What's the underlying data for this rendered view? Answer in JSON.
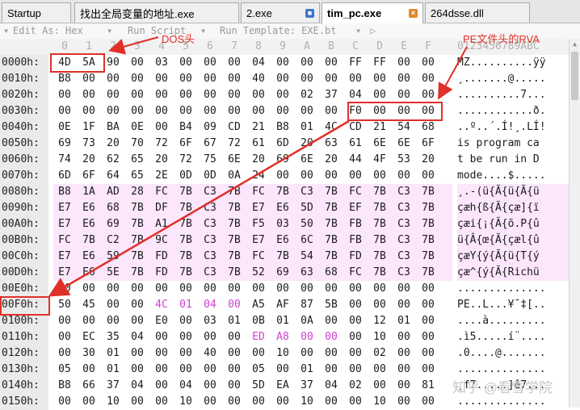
{
  "tabs": [
    {
      "label": "Startup",
      "icon": null,
      "active": false
    },
    {
      "label": "找出全局变量的地址.exe",
      "icon": null,
      "active": false
    },
    {
      "label": "2.exe",
      "icon": "lock-icon",
      "active": false
    },
    {
      "label": "tim_pc.exe",
      "icon": "close-icon",
      "active": true
    },
    {
      "label": "264dsse.dll",
      "icon": null,
      "active": false
    }
  ],
  "toolbar": {
    "edit_as": "Edit As: Hex",
    "run_script": "Run Script",
    "run_template": "Run Template: EXE.bt",
    "run_icon": "play-icon"
  },
  "columns": [
    "0",
    "1",
    "2",
    "3",
    "4",
    "5",
    "6",
    "7",
    "8",
    "9",
    "A",
    "B",
    "C",
    "D",
    "E",
    "F"
  ],
  "ascii_header": "0123456789ABC",
  "rows": [
    {
      "offset": "0000h:",
      "bytes": [
        "4D",
        "5A",
        "90",
        "00",
        "03",
        "00",
        "00",
        "00",
        "04",
        "00",
        "00",
        "00",
        "FF",
        "FF",
        "00",
        "00"
      ],
      "ascii": "MZ..........ÿÿ",
      "pink": false
    },
    {
      "offset": "0010h:",
      "bytes": [
        "B8",
        "00",
        "00",
        "00",
        "00",
        "00",
        "00",
        "00",
        "40",
        "00",
        "00",
        "00",
        "00",
        "00",
        "00",
        "00"
      ],
      "ascii": "¸.......@.....",
      "pink": false
    },
    {
      "offset": "0020h:",
      "bytes": [
        "00",
        "00",
        "00",
        "00",
        "00",
        "00",
        "00",
        "00",
        "00",
        "00",
        "02",
        "37",
        "04",
        "00",
        "00",
        "00"
      ],
      "ascii": "..........7...",
      "pink": false
    },
    {
      "offset": "0030h:",
      "bytes": [
        "00",
        "00",
        "00",
        "00",
        "00",
        "00",
        "00",
        "00",
        "00",
        "00",
        "00",
        "00",
        "F0",
        "00",
        "00",
        "00"
      ],
      "ascii": "............ð.",
      "pink": false
    },
    {
      "offset": "0040h:",
      "bytes": [
        "0E",
        "1F",
        "BA",
        "0E",
        "00",
        "B4",
        "09",
        "CD",
        "21",
        "B8",
        "01",
        "4C",
        "CD",
        "21",
        "54",
        "68"
      ],
      "ascii": "..º..´.Í!¸.LÍ!",
      "pink": false
    },
    {
      "offset": "0050h:",
      "bytes": [
        "69",
        "73",
        "20",
        "70",
        "72",
        "6F",
        "67",
        "72",
        "61",
        "6D",
        "20",
        "63",
        "61",
        "6E",
        "6E",
        "6F"
      ],
      "ascii": "is program ca",
      "pink": false
    },
    {
      "offset": "0060h:",
      "bytes": [
        "74",
        "20",
        "62",
        "65",
        "20",
        "72",
        "75",
        "6E",
        "20",
        "69",
        "6E",
        "20",
        "44",
        "4F",
        "53",
        "20"
      ],
      "ascii": "t be run in D",
      "pink": false
    },
    {
      "offset": "0070h:",
      "bytes": [
        "6D",
        "6F",
        "64",
        "65",
        "2E",
        "0D",
        "0D",
        "0A",
        "24",
        "00",
        "00",
        "00",
        "00",
        "00",
        "00",
        "00"
      ],
      "ascii": "mode....$.....",
      "pink": false
    },
    {
      "offset": "0080h:",
      "bytes": [
        "B8",
        "1A",
        "AD",
        "28",
        "FC",
        "7B",
        "C3",
        "7B",
        "FC",
        "7B",
        "C3",
        "7B",
        "FC",
        "7B",
        "C3",
        "7B"
      ],
      "ascii": "¸.-(ü{Ã{ü{Ã{ü",
      "pink": true
    },
    {
      "offset": "0090h:",
      "bytes": [
        "E7",
        "E6",
        "68",
        "7B",
        "DF",
        "7B",
        "C3",
        "7B",
        "E7",
        "E6",
        "5D",
        "7B",
        "EF",
        "7B",
        "C3",
        "7B"
      ],
      "ascii": "çæh{ß{Ã{çæ]{ï",
      "pink": true
    },
    {
      "offset": "00A0h:",
      "bytes": [
        "E7",
        "E6",
        "69",
        "7B",
        "A1",
        "7B",
        "C3",
        "7B",
        "F5",
        "03",
        "50",
        "7B",
        "FB",
        "7B",
        "C3",
        "7B"
      ],
      "ascii": "çæi{¡{Ã{õ.P{û",
      "pink": true
    },
    {
      "offset": "00B0h:",
      "bytes": [
        "FC",
        "7B",
        "C2",
        "7B",
        "9C",
        "7B",
        "C3",
        "7B",
        "E7",
        "E6",
        "6C",
        "7B",
        "FB",
        "7B",
        "C3",
        "7B"
      ],
      "ascii": "ü{Â{œ{Ã{çæl{û",
      "pink": true
    },
    {
      "offset": "00C0h:",
      "bytes": [
        "E7",
        "E6",
        "59",
        "7B",
        "FD",
        "7B",
        "C3",
        "7B",
        "FC",
        "7B",
        "54",
        "7B",
        "FD",
        "7B",
        "C3",
        "7B"
      ],
      "ascii": "çæY{ý{Ã{ü{T{ý",
      "pink": true
    },
    {
      "offset": "00D0h:",
      "bytes": [
        "E7",
        "E6",
        "5E",
        "7B",
        "FD",
        "7B",
        "C3",
        "7B",
        "52",
        "69",
        "63",
        "68",
        "FC",
        "7B",
        "C3",
        "7B"
      ],
      "ascii": "çæ^{ý{Ã{Richü",
      "pink": true
    },
    {
      "offset": "00E0h:",
      "bytes": [
        "00",
        "00",
        "00",
        "00",
        "00",
        "00",
        "00",
        "00",
        "00",
        "00",
        "00",
        "00",
        "00",
        "00",
        "00",
        "00"
      ],
      "ascii": "..............",
      "pink": false
    },
    {
      "offset": "00F0h:",
      "bytes": [
        "50",
        "45",
        "00",
        "00",
        "4C",
        "01",
        "04",
        "00",
        "A5",
        "AF",
        "87",
        "5B",
        "00",
        "00",
        "00",
        "00"
      ],
      "ascii": "PE..L...¥¯‡[..",
      "pink": false
    },
    {
      "offset": "0100h:",
      "bytes": [
        "00",
        "00",
        "00",
        "00",
        "E0",
        "00",
        "03",
        "01",
        "0B",
        "01",
        "0A",
        "00",
        "00",
        "12",
        "01",
        "00"
      ],
      "ascii": "....à.........",
      "pink": false
    },
    {
      "offset": "0110h:",
      "bytes": [
        "00",
        "EC",
        "35",
        "04",
        "00",
        "00",
        "00",
        "00",
        "ED",
        "A8",
        "00",
        "00",
        "00",
        "10",
        "00",
        "00"
      ],
      "ascii": ".ì5.....í¨....",
      "pink": false
    },
    {
      "offset": "0120h:",
      "bytes": [
        "00",
        "30",
        "01",
        "00",
        "00",
        "00",
        "40",
        "00",
        "00",
        "10",
        "00",
        "00",
        "00",
        "02",
        "00",
        "00"
      ],
      "ascii": ".0....@.......",
      "pink": false
    },
    {
      "offset": "0130h:",
      "bytes": [
        "05",
        "00",
        "01",
        "00",
        "00",
        "00",
        "00",
        "00",
        "05",
        "00",
        "01",
        "00",
        "00",
        "00",
        "00",
        "00"
      ],
      "ascii": "..............",
      "pink": false
    },
    {
      "offset": "0140h:",
      "bytes": [
        "B8",
        "66",
        "37",
        "04",
        "00",
        "04",
        "00",
        "00",
        "5D",
        "EA",
        "37",
        "04",
        "02",
        "00",
        "00",
        "81"
      ],
      "ascii": "¸f7.....]ê7...",
      "pink": false
    },
    {
      "offset": "0150h:",
      "bytes": [
        "00",
        "00",
        "10",
        "00",
        "00",
        "10",
        "00",
        "00",
        "00",
        "00",
        "10",
        "00",
        "00",
        "10",
        "00",
        "00"
      ],
      "ascii": "..............",
      "pink": false
    }
  ],
  "magenta_cells": [
    [
      15,
      4
    ],
    [
      15,
      5
    ],
    [
      15,
      6
    ],
    [
      15,
      7
    ],
    [
      17,
      8
    ],
    [
      17,
      9
    ],
    [
      17,
      10
    ],
    [
      17,
      11
    ]
  ],
  "annotations": {
    "dos_label": "DOS头",
    "pe_label": "PE文件头的RVA"
  },
  "watermark": "知乎 @看雪学院",
  "colors": {
    "accent": "#e0302a",
    "pink": "#fbe6fb",
    "magenta": "#d23fd2"
  }
}
